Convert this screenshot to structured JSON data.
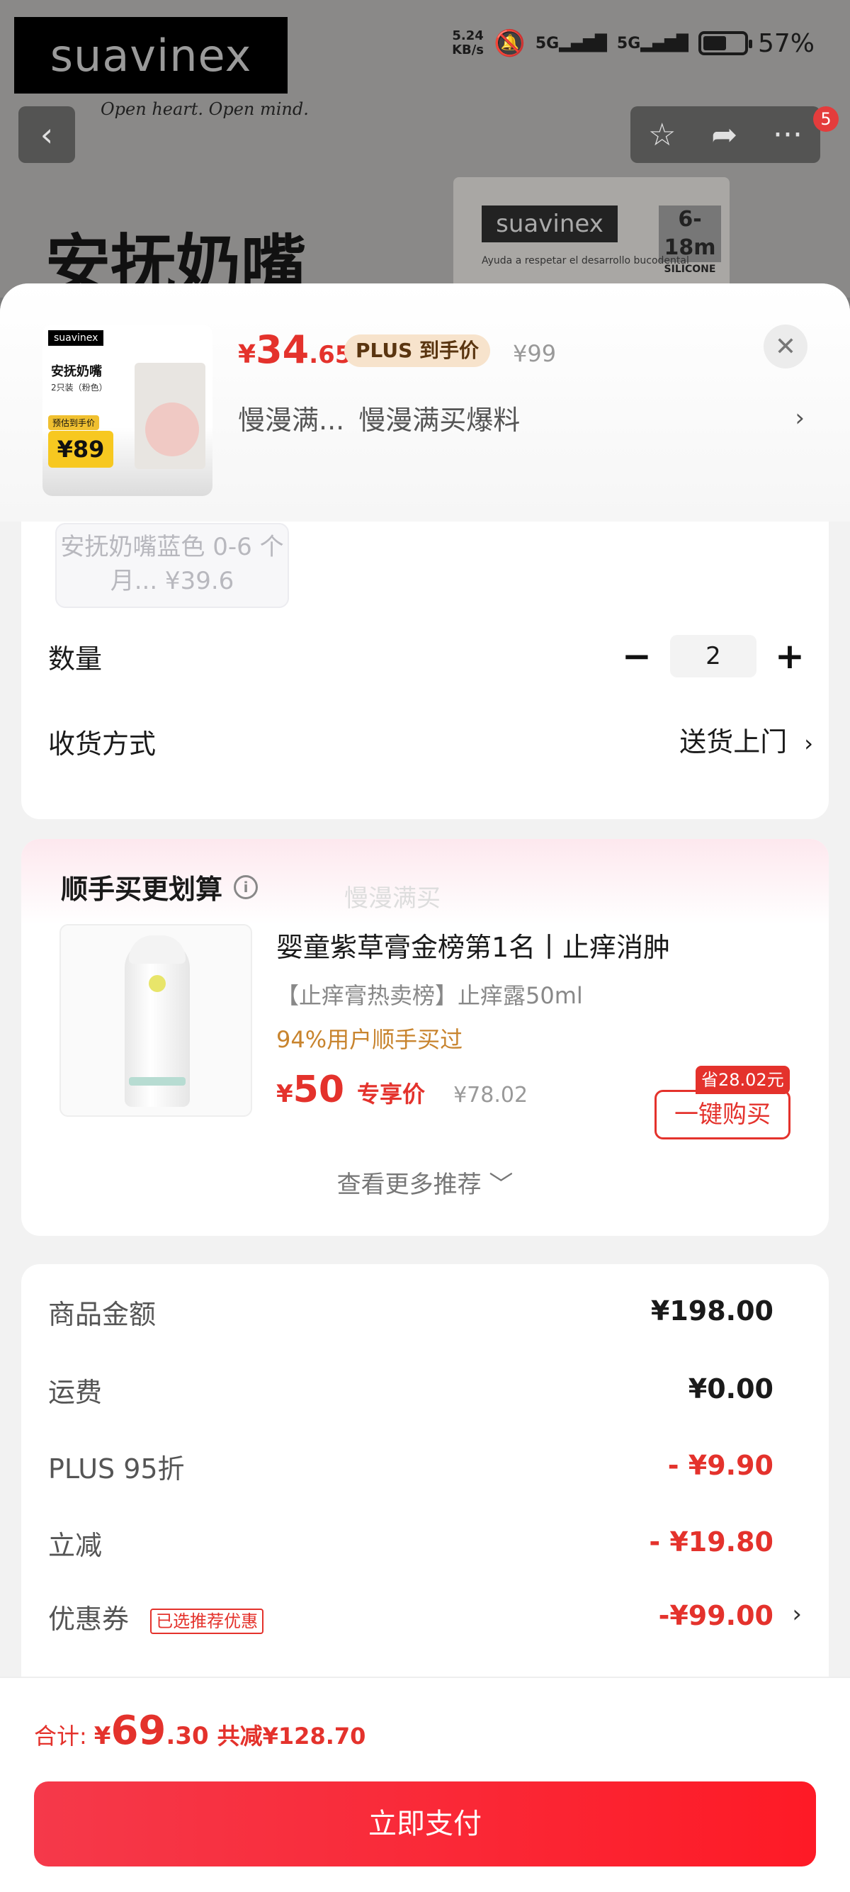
{
  "status_bar": {
    "net_speed": "5.24",
    "net_unit": "KB/s",
    "sim1": "5G",
    "sim2": "5G",
    "battery": "57%",
    "battery_level": 0.57
  },
  "background": {
    "brand": "suavinex",
    "slogan": "Open heart. Open mind.",
    "title": "安抚奶嘴",
    "pack_brand": "suavinex",
    "pack_age": "6-18m",
    "pack_material": "SILICONE",
    "pack_text": "Ayuda a respetar el desarrollo bucodental",
    "notification_count": "5"
  },
  "sheet": {
    "thumbnail": {
      "logo": "suavinex",
      "name": "安抚奶嘴",
      "sub": "2只装（粉色）",
      "pill": "预估到手价",
      "price": "¥89"
    },
    "price": {
      "yen": "¥",
      "int": "34",
      "dec": ".65",
      "plus_tag": "PLUS 到手价",
      "original": "¥99"
    },
    "promo": {
      "part1": "慢漫满...",
      "part2": "慢漫满买爆料"
    },
    "variant_label": "安抚奶嘴蓝色 0-6 个月... ¥39.6",
    "quantity": {
      "label": "数量",
      "value": "2",
      "minus": "−",
      "plus": "+"
    },
    "shipping": {
      "label": "收货方式",
      "value": "送货上门"
    }
  },
  "recommend": {
    "title": "顺手买更划算",
    "watermark": "慢漫满买",
    "name": "婴童紫草膏金榜第1名丨止痒消肿",
    "subtitle": "【止痒膏热卖榜】止痒露50ml",
    "bought": "94%用户顺手买过",
    "price_yen": "¥",
    "price_int": "50",
    "price_label": "专享价",
    "price_original": "¥78.02",
    "save_tag": "省28.02元",
    "buy_button": "一键购买",
    "see_more": "查看更多推荐 ﹀"
  },
  "amounts": [
    {
      "label": "商品金额",
      "value": "¥198.00",
      "red": false
    },
    {
      "label": "运费",
      "value": "¥0.00",
      "red": false
    },
    {
      "label": "PLUS 95折",
      "value": "- ¥9.90",
      "red": true
    },
    {
      "label": "立减",
      "value": "- ¥19.80",
      "red": true
    },
    {
      "label": "优惠券",
      "value": "-¥99.00",
      "red": true,
      "tag": "已选推荐优惠"
    }
  ],
  "footer": {
    "total_label": "合计:",
    "yen": "¥",
    "int": "69",
    "dec": ".30",
    "saved": "共减¥128.70",
    "pay_button": "立即支付"
  },
  "colors": {
    "accent_red": "#e4322c",
    "plus_tag_bg": "#f7e3cc",
    "bought_orange": "#c8842e"
  }
}
